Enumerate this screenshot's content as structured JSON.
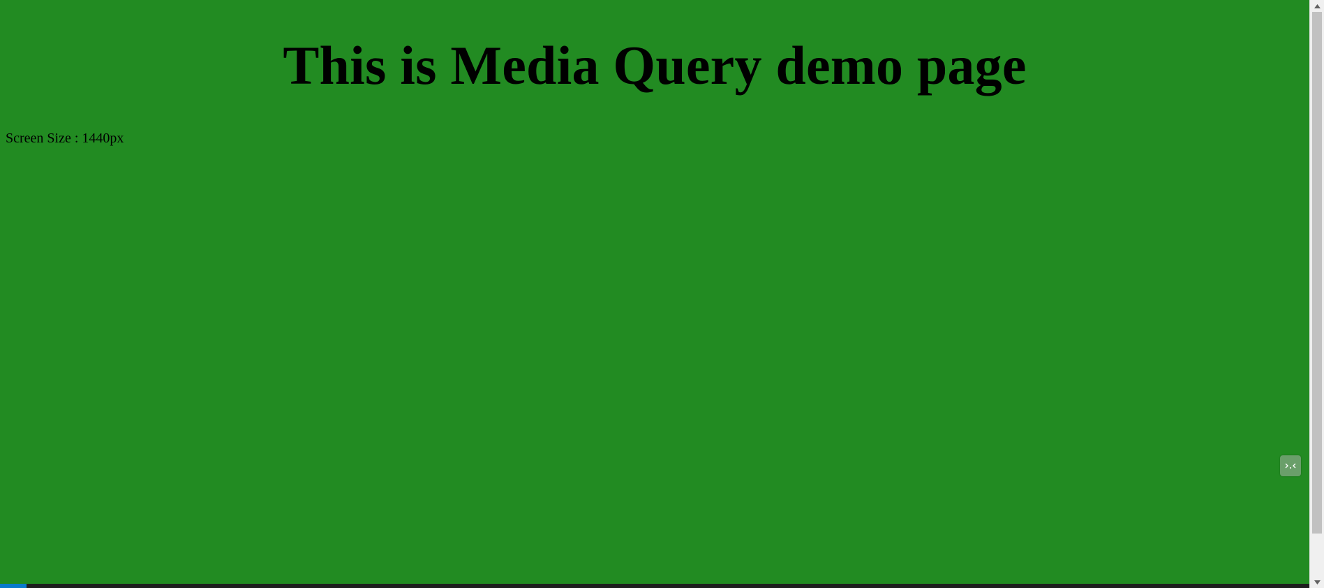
{
  "page": {
    "background_color": "#228b22",
    "heading": "This is Media Query demo page",
    "screen_size_text": "Screen Size : 1440px"
  },
  "overlay": {
    "floating_button_icon": "code-brackets-icon"
  },
  "colors": {
    "page_bg": "#228b22",
    "scrollbar_track": "#f0f0f0",
    "scrollbar_thumb": "#c1c1c1",
    "floating_button": "#6a9f6a",
    "status_bar": "#1e1e1e",
    "status_accent": "#0a7acc"
  }
}
